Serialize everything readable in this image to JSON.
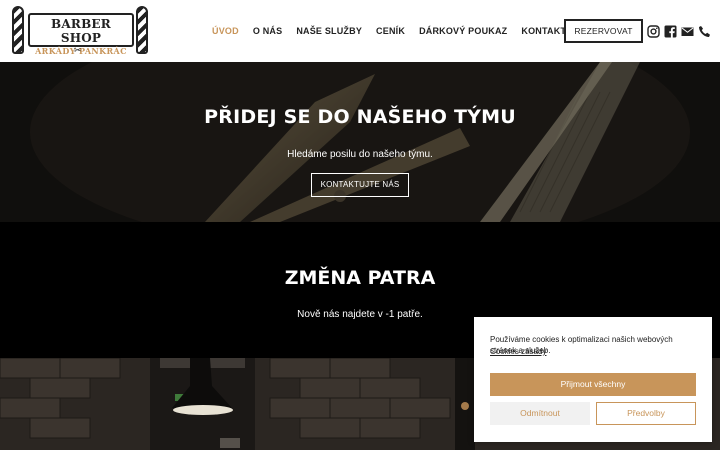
{
  "logo": {
    "line1": "BARBER SHOP",
    "line2": "ARKÁDY PANKRÁC",
    "scissor": "✂"
  },
  "nav": {
    "items": [
      {
        "label": "ÚVOD",
        "active": true
      },
      {
        "label": "O NÁS",
        "active": false
      },
      {
        "label": "NAŠE SLUŽBY",
        "active": false
      },
      {
        "label": "CENÍK",
        "active": false
      },
      {
        "label": "DÁRKOVÝ POUKAZ",
        "active": false
      },
      {
        "label": "KONTAKT",
        "active": false
      }
    ],
    "reserve_label": "REZERVOVAT"
  },
  "social": [
    "instagram-icon",
    "facebook-icon",
    "email-icon",
    "phone-icon"
  ],
  "hero": {
    "title": "PŘIDEJ SE DO NAŠEHO TÝMU",
    "subtitle": "Hledáme posilu do našeho týmu.",
    "button_label": "KONTAKTUJTE NÁS"
  },
  "notice": {
    "title": "ZMĚNA PATRA",
    "text": "Nově nás najdete v -1 patře."
  },
  "cookie": {
    "text": "Používáme cookies k optimalizaci našich webových stránek a služeb.",
    "link": "Cookies zásady",
    "accept_label": "Přijmout všechny",
    "decline_label": "Odmítnout",
    "prefs_label": "Předvolby"
  },
  "colors": {
    "accent": "#c8955a",
    "dark": "#222222"
  }
}
